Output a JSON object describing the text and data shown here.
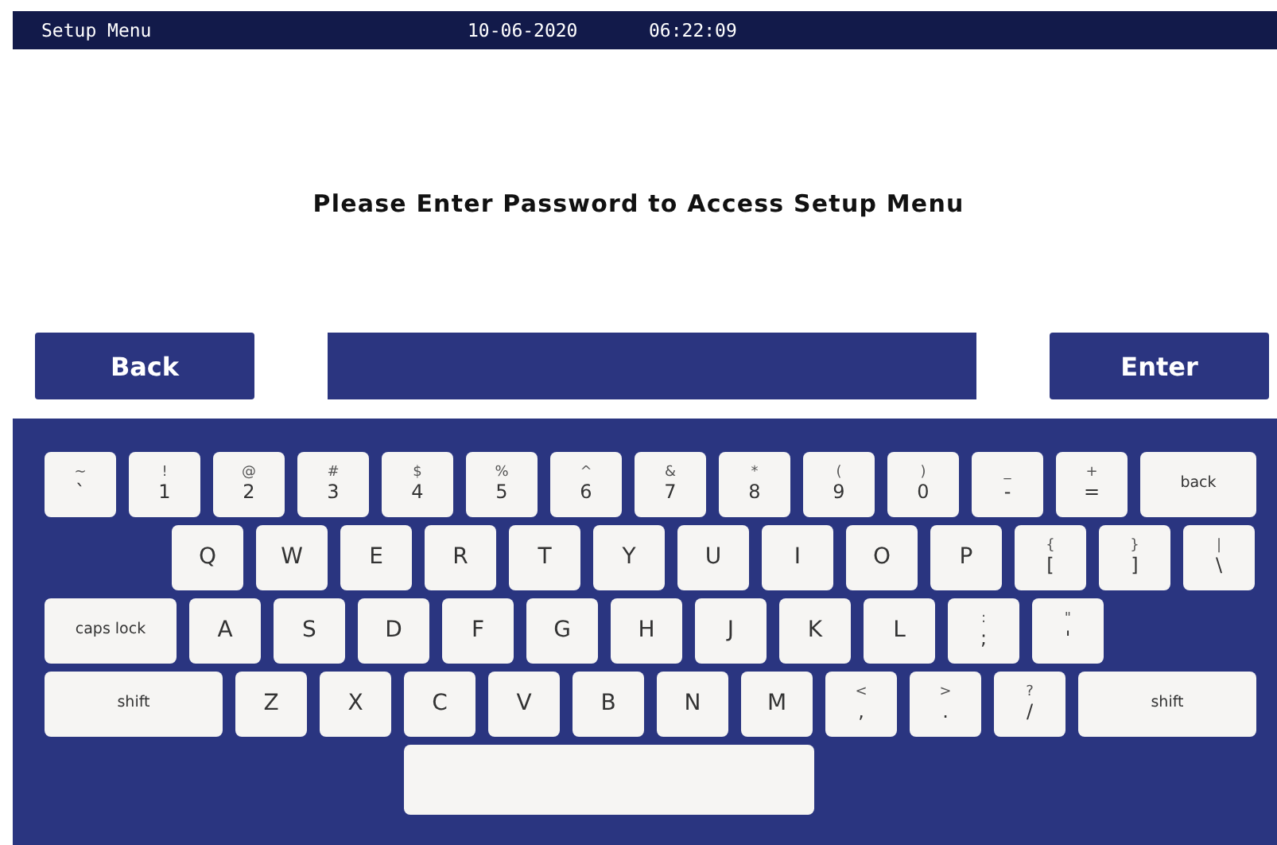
{
  "status_bar": {
    "title": "Setup Menu",
    "date": "10-06-2020",
    "time": "06:22:09"
  },
  "prompt": "Please Enter Password to Access Setup Menu",
  "buttons": {
    "back": "Back",
    "enter": "Enter"
  },
  "keyboard": {
    "rows": [
      [
        {
          "kind": "dual",
          "shift": "~",
          "label": "`"
        },
        {
          "kind": "dual",
          "shift": "!",
          "label": "1"
        },
        {
          "kind": "dual",
          "shift": "@",
          "label": "2"
        },
        {
          "kind": "dual",
          "shift": "#",
          "label": "3"
        },
        {
          "kind": "dual",
          "shift": "$",
          "label": "4"
        },
        {
          "kind": "dual",
          "shift": "%",
          "label": "5"
        },
        {
          "kind": "dual",
          "shift": "^",
          "label": "6"
        },
        {
          "kind": "dual",
          "shift": "&",
          "label": "7"
        },
        {
          "kind": "dual",
          "shift": "*",
          "label": "8"
        },
        {
          "kind": "dual",
          "shift": "(",
          "label": "9"
        },
        {
          "kind": "dual",
          "shift": ")",
          "label": "0"
        },
        {
          "kind": "dual",
          "shift": "_",
          "label": "-"
        },
        {
          "kind": "dual",
          "shift": "+",
          "label": "="
        },
        {
          "kind": "backspace",
          "label": "back"
        }
      ],
      [
        {
          "kind": "letter",
          "label": "Q"
        },
        {
          "kind": "letter",
          "label": "W"
        },
        {
          "kind": "letter",
          "label": "E"
        },
        {
          "kind": "letter",
          "label": "R"
        },
        {
          "kind": "letter",
          "label": "T"
        },
        {
          "kind": "letter",
          "label": "Y"
        },
        {
          "kind": "letter",
          "label": "U"
        },
        {
          "kind": "letter",
          "label": "I"
        },
        {
          "kind": "letter",
          "label": "O"
        },
        {
          "kind": "letter",
          "label": "P"
        },
        {
          "kind": "dual",
          "shift": "{",
          "label": "["
        },
        {
          "kind": "dual",
          "shift": "}",
          "label": "]"
        },
        {
          "kind": "dual",
          "shift": "|",
          "label": "\\"
        }
      ],
      [
        {
          "kind": "capslock",
          "label": "caps lock"
        },
        {
          "kind": "letter",
          "label": "A"
        },
        {
          "kind": "letter",
          "label": "S"
        },
        {
          "kind": "letter",
          "label": "D"
        },
        {
          "kind": "letter",
          "label": "F"
        },
        {
          "kind": "letter",
          "label": "G"
        },
        {
          "kind": "letter",
          "label": "H"
        },
        {
          "kind": "letter",
          "label": "J"
        },
        {
          "kind": "letter",
          "label": "K"
        },
        {
          "kind": "letter",
          "label": "L"
        },
        {
          "kind": "dual",
          "shift": ":",
          "label": ";"
        },
        {
          "kind": "dual",
          "shift": "\"",
          "label": "'"
        }
      ],
      [
        {
          "kind": "shift",
          "label": "shift"
        },
        {
          "kind": "letter",
          "label": "Z"
        },
        {
          "kind": "letter",
          "label": "X"
        },
        {
          "kind": "letter",
          "label": "C"
        },
        {
          "kind": "letter",
          "label": "V"
        },
        {
          "kind": "letter",
          "label": "B"
        },
        {
          "kind": "letter",
          "label": "N"
        },
        {
          "kind": "letter",
          "label": "M"
        },
        {
          "kind": "dual",
          "shift": "<",
          "label": ","
        },
        {
          "kind": "dual",
          "shift": ">",
          "label": "."
        },
        {
          "kind": "dual",
          "shift": "?",
          "label": "/"
        },
        {
          "kind": "shift",
          "label": "shift"
        }
      ],
      [
        {
          "kind": "space"
        }
      ]
    ]
  }
}
